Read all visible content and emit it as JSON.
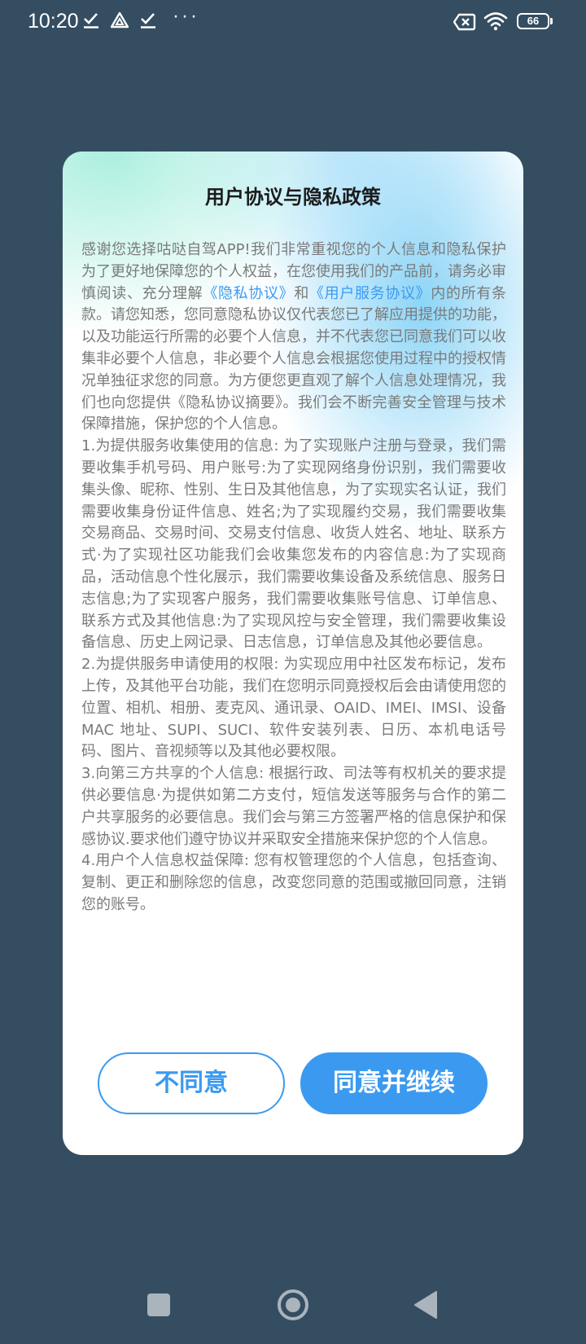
{
  "status_bar": {
    "time": "10:20",
    "dots": "···",
    "battery": "66",
    "icons": [
      "check-download-icon",
      "drive-icon",
      "check-download-icon",
      "sim-off-icon",
      "wifi-icon",
      "battery-icon"
    ]
  },
  "dialog": {
    "title": "用户协议与隐私政策",
    "intro_part1": "感谢您选择咕哒自驾APP!我们非常重视您的个人信息和隐私保护为了更好地保障您的个人权益，在您使用我们的产品前，请务必审慎阅读、充分理解",
    "privacy_link": "《隐私协议》",
    "and_text": "和",
    "service_link": "《用户服务协议》",
    "intro_part2": "内的所有条款。请您知悉，您同意隐私协议仅代表您已了解应用提供的功能，以及功能运行所需的必要个人信息，并不代表您已同意我们可以收集非必要个人信息，非必要个人信息会根据您使用过程中的授权情况单独征求您的同意。为方便您更直观了解个人信息处理情况，我们也向您提供《隐私协议摘要》。我们会不断完善安全管理与技术保障措施，保护您的个人信息。",
    "section1": "1.为提供服务收集使用的信息: 为了实现账户注册与登录，我们需要收集手机号码、用户账号:为了实现网络身份识别，我们需要收集头像、昵称、性别、生日及其他信息，为了实现实名认证，我们需要收集身份证件信息、姓名;为了实现履约交易，我们需要收集交易商品、交易时间、交易支付信息、收货人姓名、地址、联系方式·为了实现社区功能我们会收集您发布的内容信息:为了实现商品，活动信息个性化展示，我们需要收集设备及系统信息、服务日志信息;为了实现客户服务，我们需要收集账号信息、订单信息、联系方式及其他信息:为了实现风控与安全管理，我们需要收集设备信息、历史上网记录、日志信息，订单信息及其他必要信息。",
    "section2": "2.为提供服务申请使用的权限: 为实现应用中社区发布标记，发布上传，及其他平台功能，我们在您明示同竟授权后会由请使用您的位置、相机、相册、麦克风、通讯录、OAID、IMEI、IMSI、设备 MAC 地址、SUPI、SUCI、软件安装列表、日历、本机电话号码、图片、音视频等以及其他必要权限。",
    "section3": "3.向第三方共享的个人信息: 根据行政、司法等有权机关的要求提供必要信息·为提供如第二方支付，短信发送等服务与合作的第二户共享服务的必要信息。我们会与第三方签署严格的信息保护和保感协议.要求他们遵守协议并采取安全措施来保护您的个人信息。",
    "section4": "4.用户个人信息权益保障: 您有权管理您的个人信息，包括查询、复制、更正和删除您的信息，改变您同意的范围或撤回同意，注销您的账号。",
    "disagree_label": "不同意",
    "agree_label": "同意并继续"
  },
  "colors": {
    "backdrop": "#354d61",
    "accent": "#3b9af0",
    "body_text": "#7a7a7a"
  },
  "navbar": {
    "icons": [
      "recent-apps-icon",
      "home-icon",
      "back-icon"
    ]
  }
}
